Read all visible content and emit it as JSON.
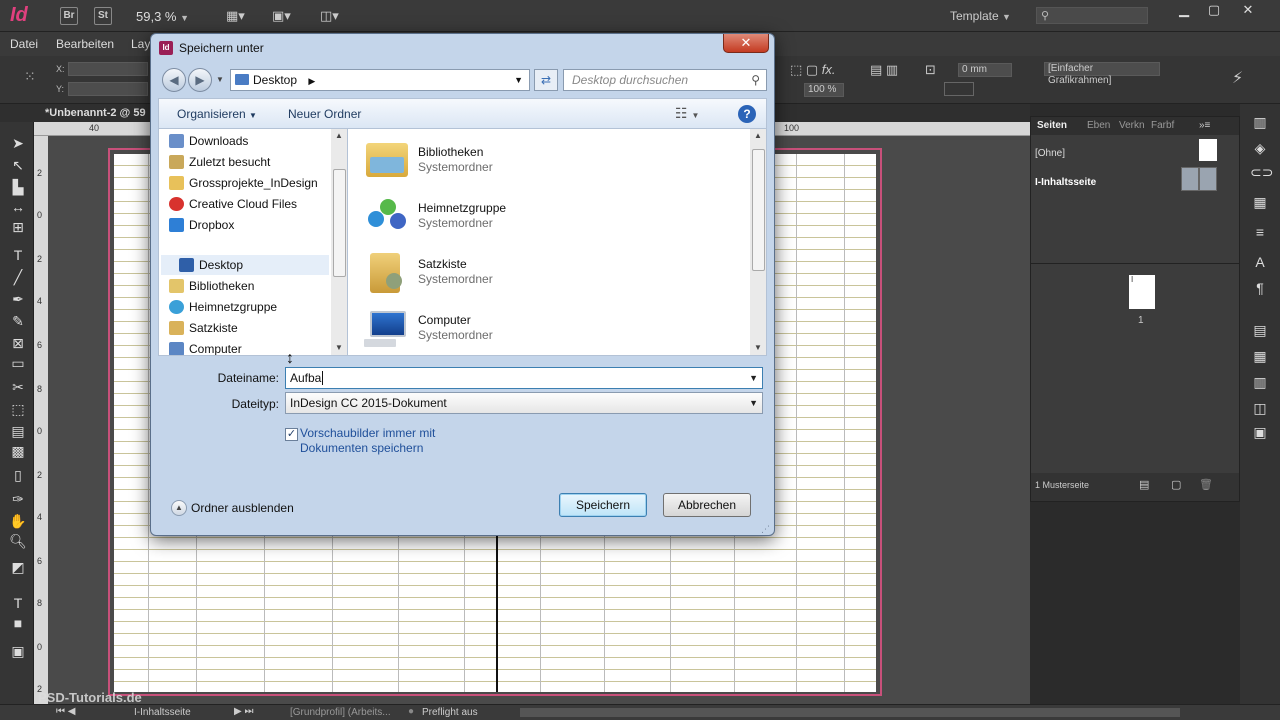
{
  "app": {
    "logo": "Id",
    "bridge": "Br",
    "stock": "St",
    "zoom": "59,3 %",
    "workspace": "Template",
    "menus": [
      "Datei",
      "Bearbeiten",
      "Lay"
    ],
    "control": {
      "x_label": "X:",
      "y_label": "Y:",
      "stroke_weight": "0 mm",
      "opacity": "100 %",
      "frame_style": "[Einfacher Grafikrahmen]"
    },
    "doc_tab": "*Unbenannt-2 @ 59",
    "ruler_h": [
      "40",
      "100"
    ],
    "ruler_v": [
      "2",
      "0",
      "2",
      "4",
      "6",
      "8",
      "0",
      "2",
      "4",
      "6",
      "8",
      "0",
      "2"
    ],
    "watermark": "PSD-Tutorials.de"
  },
  "pages_panel": {
    "tabs": [
      "Seiten",
      "Eben",
      "Verkn",
      "Farbf"
    ],
    "masters": [
      "[Ohne]",
      "I-Inhaltsseite"
    ],
    "page_number": "1",
    "page_prefix": "I",
    "footer": "1 Musterseite"
  },
  "status": {
    "master": "I-Inhaltsseite",
    "profile": "[Grundprofil] (Arbeits...",
    "preflight": "Preflight aus"
  },
  "dialog": {
    "title": "Speichern unter",
    "icon_text": "Id",
    "close": "✕",
    "address": "Desktop",
    "search_placeholder": "Desktop durchsuchen",
    "organize": "Organisieren",
    "new_folder": "Neuer Ordner",
    "help": "?",
    "nav_items": [
      "Downloads",
      "Zuletzt besucht",
      "Grossprojekte_InDesign",
      "Creative Cloud Files",
      "Dropbox",
      "Desktop",
      "Bibliotheken",
      "Heimnetzgruppe",
      "Satzkiste",
      "Computer"
    ],
    "files": [
      {
        "name": "Bibliotheken",
        "type": "Systemordner"
      },
      {
        "name": "Heimnetzgruppe",
        "type": "Systemordner"
      },
      {
        "name": "Satzkiste",
        "type": "Systemordner"
      },
      {
        "name": "Computer",
        "type": "Systemordner"
      }
    ],
    "filename_label": "Dateiname:",
    "filename_value": "Aufba",
    "filetype_label": "Dateityp:",
    "filetype_value": "InDesign CC 2015-Dokument",
    "preview_checkbox": "Vorschaubilder immer mit Dokumenten speichern",
    "hide_folders": "Ordner ausblenden",
    "save": "Speichern",
    "cancel": "Abbrechen"
  }
}
